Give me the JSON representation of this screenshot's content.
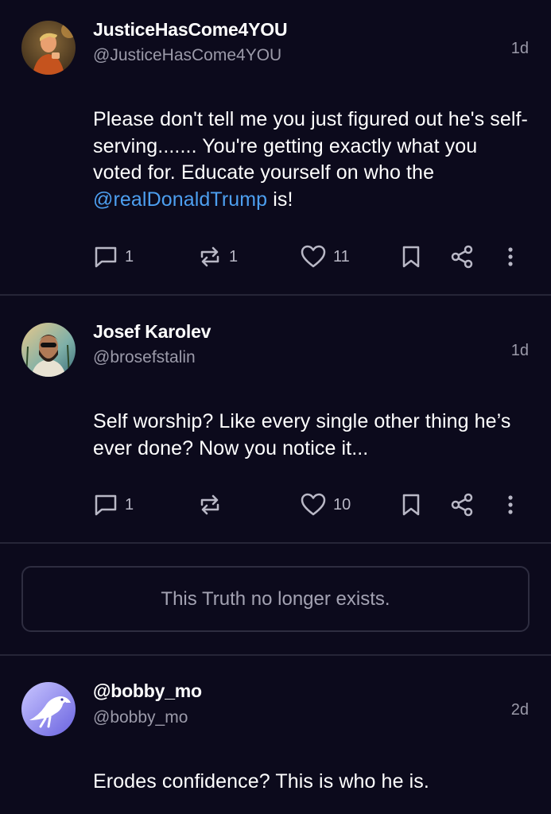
{
  "posts": [
    {
      "display_name": "JusticeHasCome4YOU",
      "handle": "@JusticeHasCome4YOU",
      "time": "1d",
      "text_before": "Please don't tell me you just figured out he's self-serving....... You're getting exactly what you voted for. Educate yourself on who the ",
      "mention": "@realDonaldTrump",
      "text_after": " is!",
      "actions": {
        "replies": "1",
        "retruths": "1",
        "likes": "11"
      }
    },
    {
      "display_name": "Josef Karolev",
      "handle": "@brosefstalin",
      "time": "1d",
      "text_before": "Self worship? Like every single other thing he’s ever done? Now you notice it...",
      "mention": "",
      "text_after": "",
      "actions": {
        "replies": "1",
        "retruths": "",
        "likes": "10"
      }
    },
    {
      "display_name": "@bobby_mo",
      "handle": "@bobby_mo",
      "time": "2d",
      "text_before": "Erodes confidence? This is who he is.",
      "mention": "",
      "text_after": ""
    }
  ],
  "deleted_notice": "This Truth no longer exists.",
  "icons": {
    "reply": "comment-icon",
    "retruth": "retruth-icon",
    "like": "heart-icon",
    "bookmark": "bookmark-icon",
    "share": "share-icon",
    "more": "more-vertical-icon"
  },
  "colors": {
    "background": "#0c0a1c",
    "mention": "#4d9ff0",
    "muted": "#9b9aa9",
    "divider": "#262537"
  }
}
